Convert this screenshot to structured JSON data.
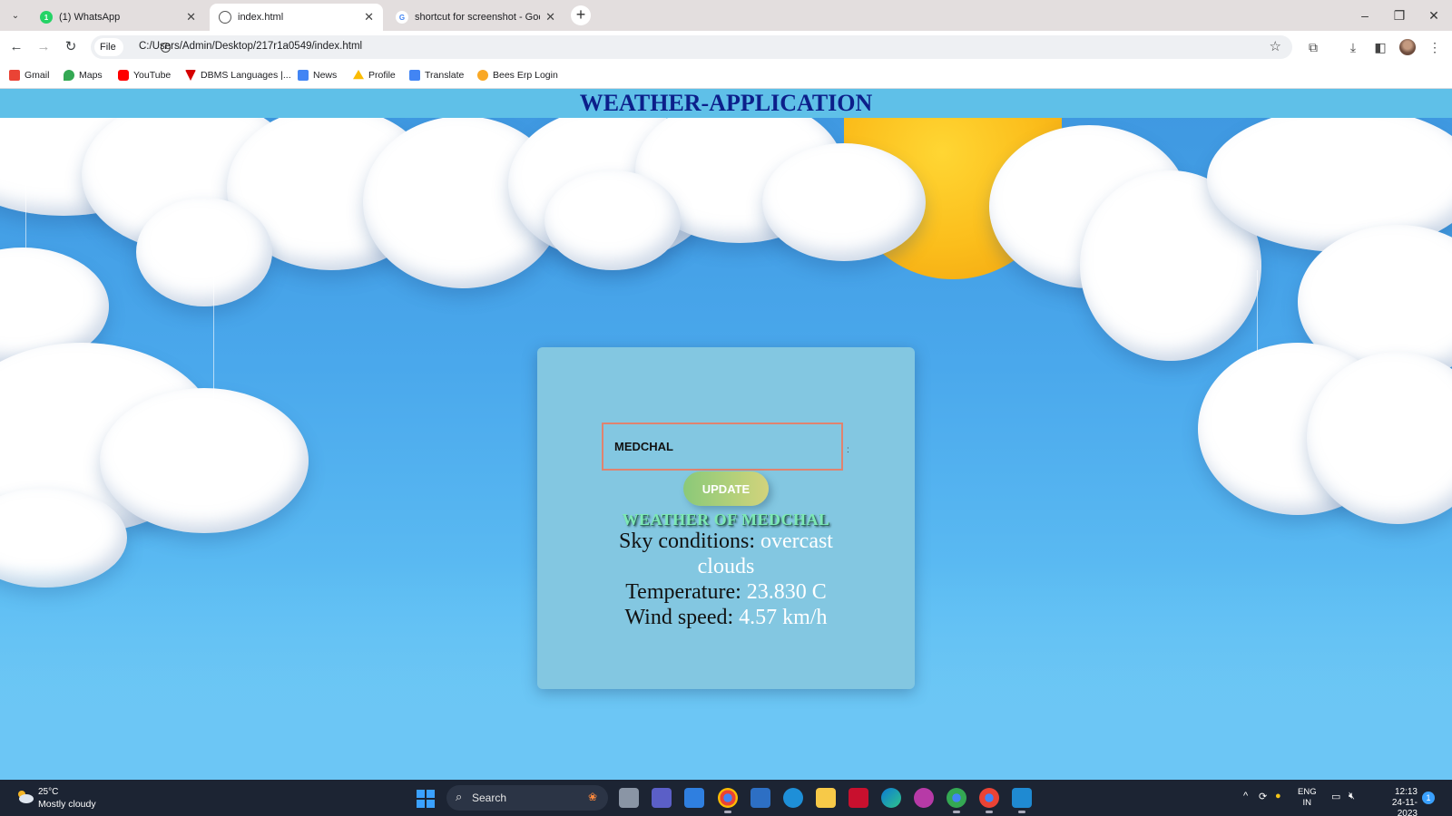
{
  "browser": {
    "tabs": [
      {
        "title": "(1) WhatsApp",
        "favicon": "whatsapp-icon",
        "favicon_text": "1",
        "active": false
      },
      {
        "title": "index.html",
        "favicon": "globe-icon",
        "active": true
      },
      {
        "title": "shortcut for screenshot - Googl",
        "favicon": "google-icon",
        "favicon_text": "G",
        "active": false
      }
    ],
    "new_tab": "+",
    "address": {
      "chip": "File",
      "url": "C:/Users/Admin/Desktop/217r1a0549/index.html"
    },
    "bookmarks": [
      {
        "label": "Gmail",
        "icon": "gmail-icon",
        "color": "#ea4335"
      },
      {
        "label": "Maps",
        "icon": "maps-icon",
        "color": "#34a853"
      },
      {
        "label": "YouTube",
        "icon": "youtube-icon",
        "color": "#ff0000"
      },
      {
        "label": "DBMS Languages |...",
        "icon": "dbms-icon",
        "color": "#d50000"
      },
      {
        "label": "News",
        "icon": "news-icon",
        "color": "#4285f4"
      },
      {
        "label": "Profile",
        "icon": "drive-icon",
        "color": "#fbbc04"
      },
      {
        "label": "Translate",
        "icon": "translate-icon",
        "color": "#4285f4"
      },
      {
        "label": "Bees Erp Login",
        "icon": "bee-icon",
        "color": "#f9a825"
      }
    ]
  },
  "app": {
    "title": "WEATHER-APPLICATION",
    "city_input": {
      "value": "MEDCHAL",
      "suffix": ":"
    },
    "update_label": "UPDATE",
    "weather_heading": "WEATHER OF MEDCHAL",
    "sky": {
      "label": "Sky conditions:",
      "value": "overcast clouds"
    },
    "temperature": {
      "label": "Temperature:",
      "value": "23.830 C"
    },
    "wind": {
      "label": "Wind speed:",
      "value": "4.57 km/h"
    }
  },
  "taskbar": {
    "weather": {
      "temp": "25°C",
      "desc": "Mostly cloudy"
    },
    "search_label": "Search",
    "lang": {
      "line1": "ENG",
      "line2": "IN"
    },
    "clock": {
      "time": "12:13",
      "date": "24-11-2023"
    },
    "notifications": "1"
  },
  "colors": {
    "header_bar": "#5fc0e8",
    "title": "#0c1f8a",
    "card": "#83c7e1",
    "input_border": "#e0836f",
    "heading_green": "#7de8b4"
  }
}
